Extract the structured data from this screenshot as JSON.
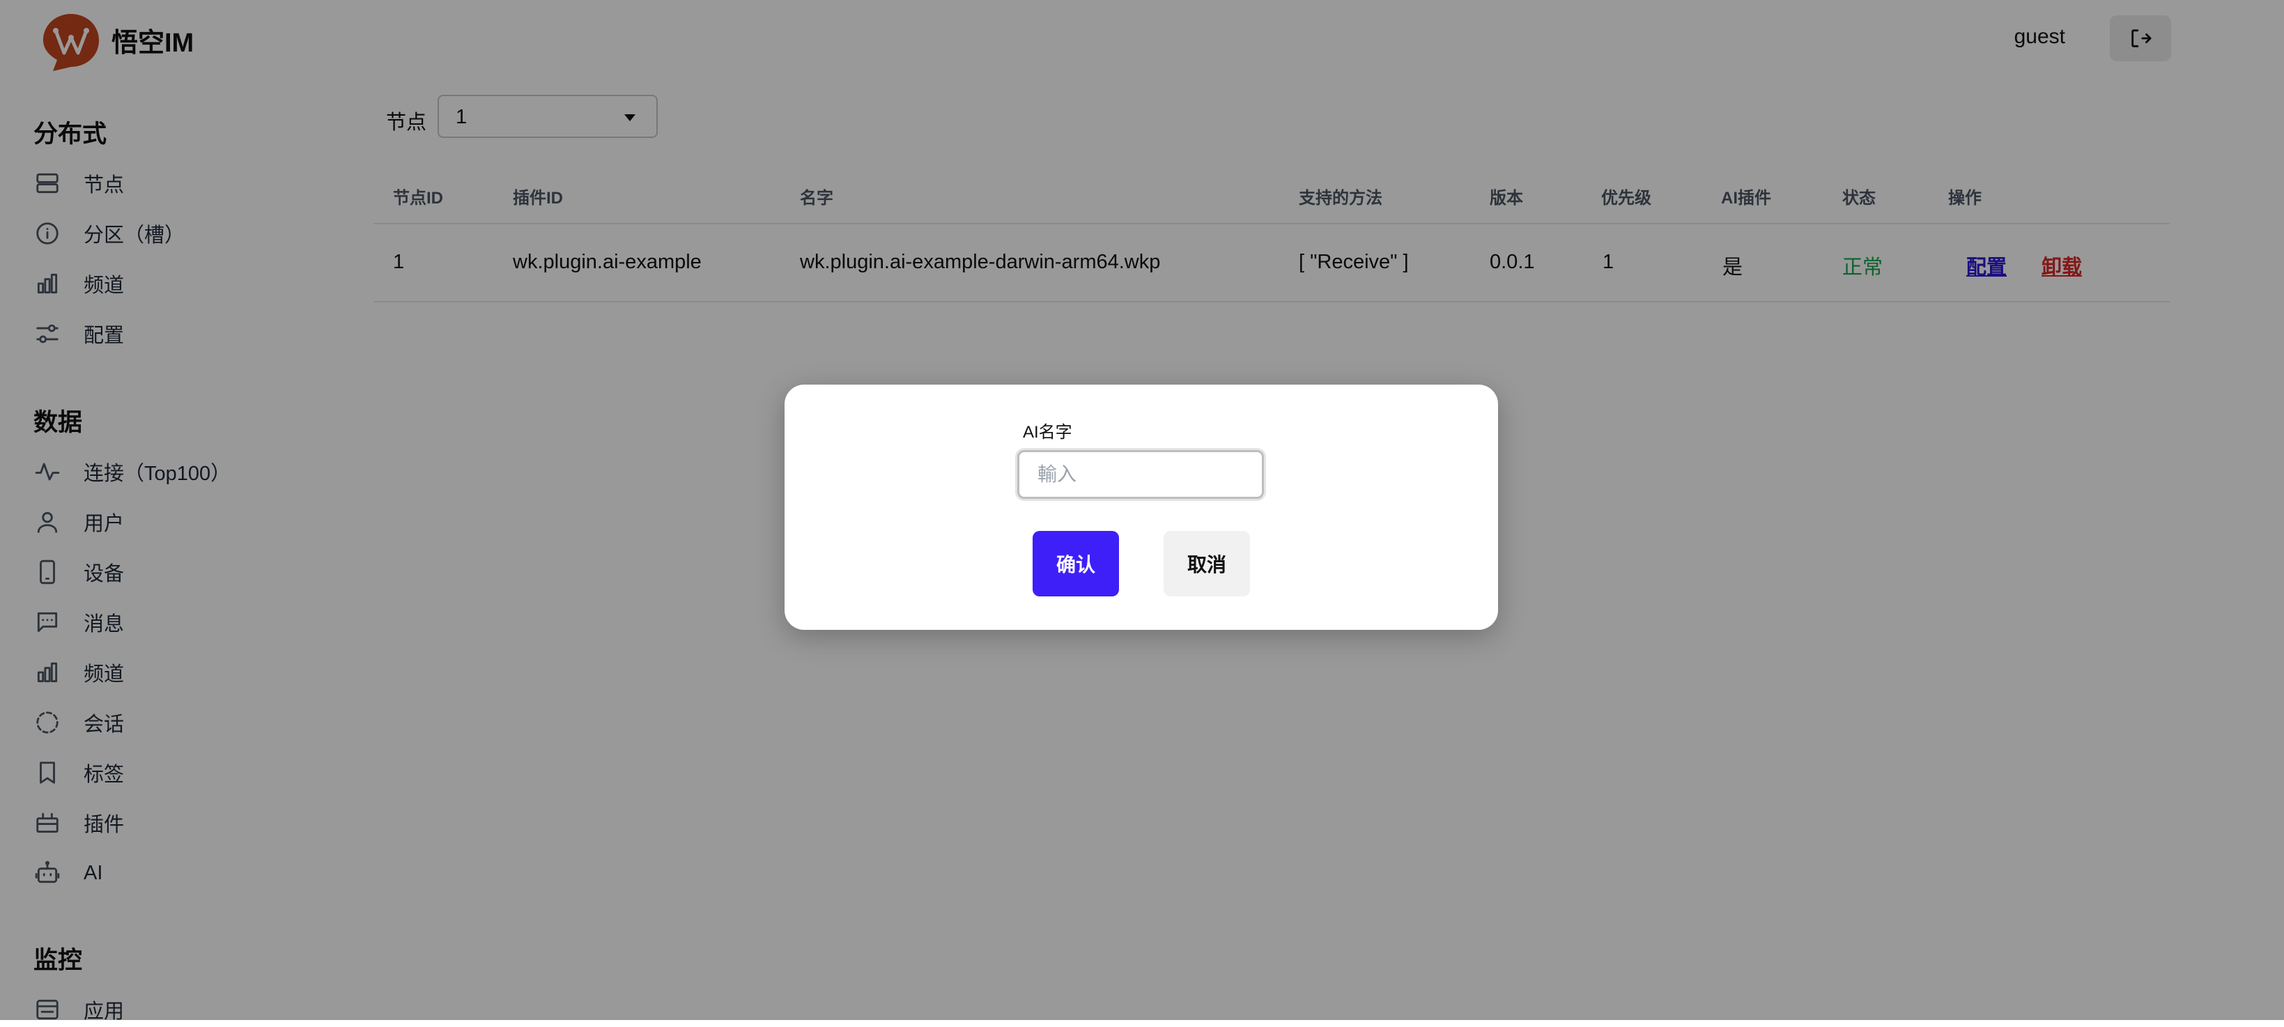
{
  "app": {
    "brand": "悟空IM",
    "logo_icon": "wukong-logo-icon",
    "user": "guest",
    "logout_icon": "logout-icon"
  },
  "sidebar": {
    "sections": [
      {
        "title": "分布式",
        "items": [
          {
            "label": "节点",
            "icon": "server-icon"
          },
          {
            "label": "分区（槽）",
            "icon": "info-icon"
          },
          {
            "label": "频道",
            "icon": "bar-chart-icon"
          },
          {
            "label": "配置",
            "icon": "sliders-icon"
          }
        ]
      },
      {
        "title": "数据",
        "items": [
          {
            "label": "连接（Top100）",
            "icon": "activity-icon"
          },
          {
            "label": "用户",
            "icon": "user-icon"
          },
          {
            "label": "设备",
            "icon": "phone-icon"
          },
          {
            "label": "消息",
            "icon": "message-icon"
          },
          {
            "label": "频道",
            "icon": "bar-chart-icon"
          },
          {
            "label": "会话",
            "icon": "dashed-circle-icon"
          },
          {
            "label": "标签",
            "icon": "bookmark-icon"
          },
          {
            "label": "插件",
            "icon": "plugin-icon"
          },
          {
            "label": "AI",
            "icon": "bot-icon"
          }
        ]
      },
      {
        "title": "监控",
        "items": [
          {
            "label": "应用",
            "icon": "app-icon"
          }
        ]
      }
    ]
  },
  "main": {
    "node_filter": {
      "label": "节点",
      "value": "1"
    },
    "table": {
      "columns": [
        "节点ID",
        "插件ID",
        "名字",
        "支持的方法",
        "版本",
        "优先级",
        "AI插件",
        "状态",
        "操作"
      ],
      "rows": [
        {
          "node_id": "1",
          "plugin_id": "wk.plugin.ai-example",
          "name": "wk.plugin.ai-example-darwin-arm64.wkp",
          "methods": "[ \"Receive\" ]",
          "version": "0.0.1",
          "priority": "1",
          "ai_plugin": "是",
          "status": "正常",
          "status_color": "#16a34a",
          "actions": {
            "config": "配置",
            "uninstall": "卸载"
          }
        }
      ]
    }
  },
  "modal": {
    "label": "AI名字",
    "input_value": "",
    "placeholder": "輸入",
    "confirm": "确认",
    "cancel": "取消",
    "confirm_color": "#3f1ff8"
  }
}
